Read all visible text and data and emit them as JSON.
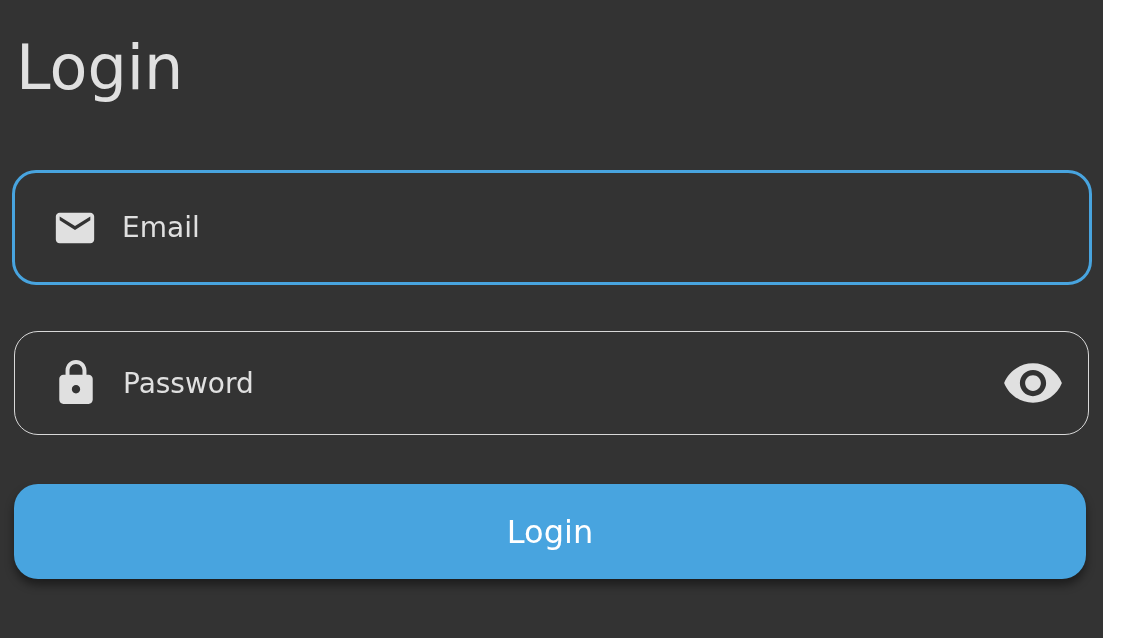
{
  "title": "Login",
  "fields": [
    {
      "kind": "email",
      "placeholder": "Email",
      "focused": true
    },
    {
      "kind": "password",
      "placeholder": "Password",
      "focused": false
    }
  ],
  "button": {
    "label": "Login"
  }
}
